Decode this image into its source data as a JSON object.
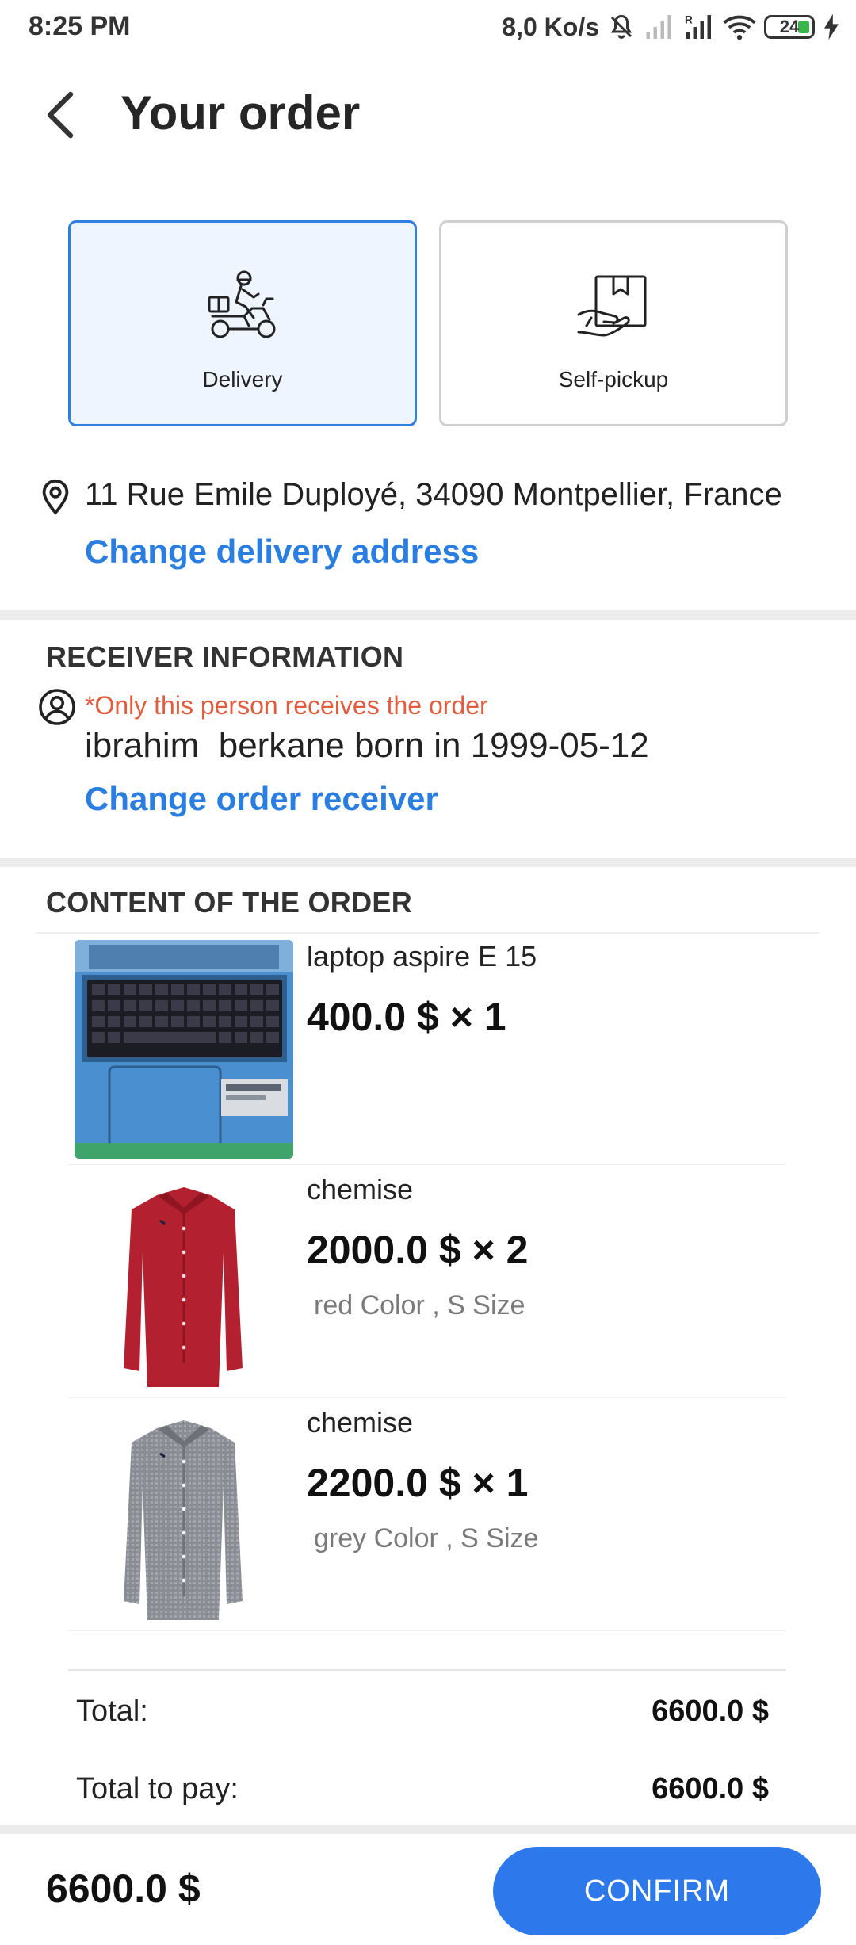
{
  "status_bar": {
    "time": "8:25 PM",
    "net_speed": "8,0 Ko/s",
    "battery": "24",
    "icons": [
      "mute-icon",
      "signal-icon",
      "signal-roaming-icon",
      "wifi-icon",
      "battery-icon",
      "charging-icon"
    ]
  },
  "header": {
    "title": "Your order",
    "back_icon": "back-arrow-icon"
  },
  "delivery_modes": [
    {
      "label": "Delivery",
      "icon": "scooter-courier-icon",
      "selected": true
    },
    {
      "label": "Self-pickup",
      "icon": "package-hand-icon",
      "selected": false
    }
  ],
  "address": {
    "icon": "location-pin-icon",
    "text": "11 Rue Emile Duployé, 34090 Montpellier, France",
    "change_label": "Change delivery address"
  },
  "receiver": {
    "title": "RECEIVER INFORMATION",
    "icon": "user-circle-icon",
    "note": "*Only this person receives the order",
    "name": "ibrahim  berkane born in 1999-05-12",
    "change_label": "Change order receiver"
  },
  "order": {
    "title": "CONTENT OF THE ORDER",
    "items": [
      {
        "name": "laptop aspire E 15",
        "price": "400.0 $ × 1",
        "variant": "",
        "image": "laptop-photo"
      },
      {
        "name": "chemise",
        "price": "2000.0 $ × 2",
        "variant": "red Color , S Size",
        "image": "red-shirt-photo"
      },
      {
        "name": "chemise",
        "price": "2200.0 $ × 1",
        "variant": "grey Color , S Size",
        "image": "grey-shirt-photo"
      }
    ]
  },
  "totals": {
    "total_label": "Total:",
    "total_value": "6600.0 $",
    "to_pay_label": "Total to pay:",
    "to_pay_value": "6600.0 $"
  },
  "footer": {
    "amount": "6600.0 $",
    "confirm_label": "CONFIRM"
  },
  "colors": {
    "accent": "#2a7de1",
    "button": "#2d79ec",
    "warning": "#e25c3e",
    "selected_bg": "#eef5fe"
  }
}
